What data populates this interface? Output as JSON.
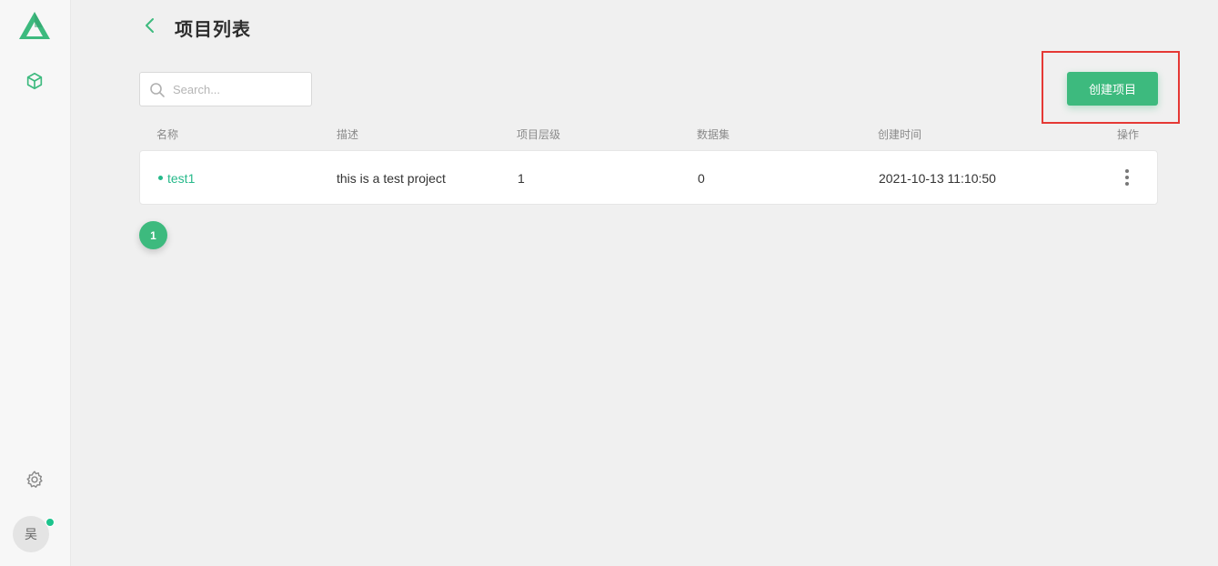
{
  "header": {
    "title": "项目列表"
  },
  "search": {
    "placeholder": "Search..."
  },
  "toolbar": {
    "create_label": "创建项目"
  },
  "table": {
    "columns": [
      "名称",
      "描述",
      "项目层级",
      "数据集",
      "创建时间",
      "操作"
    ],
    "rows": [
      {
        "name": "test1",
        "description": "this is a test project",
        "level": "1",
        "datasets": "0",
        "created": "2021-10-13 11:10:50"
      }
    ]
  },
  "pagination": {
    "current_page": "1"
  },
  "user": {
    "avatar_text": "吴",
    "online": true
  },
  "icons": {
    "logo": "triangle-logo-icon",
    "nav": "cube-icon",
    "settings": "gear-icon",
    "back": "chevron-left-icon",
    "search": "search-icon",
    "more": "more-vertical-icon"
  },
  "colors": {
    "accent": "#3dba7e",
    "link": "#26b98a",
    "highlight": "#e53935",
    "online": "#1cc38c"
  }
}
